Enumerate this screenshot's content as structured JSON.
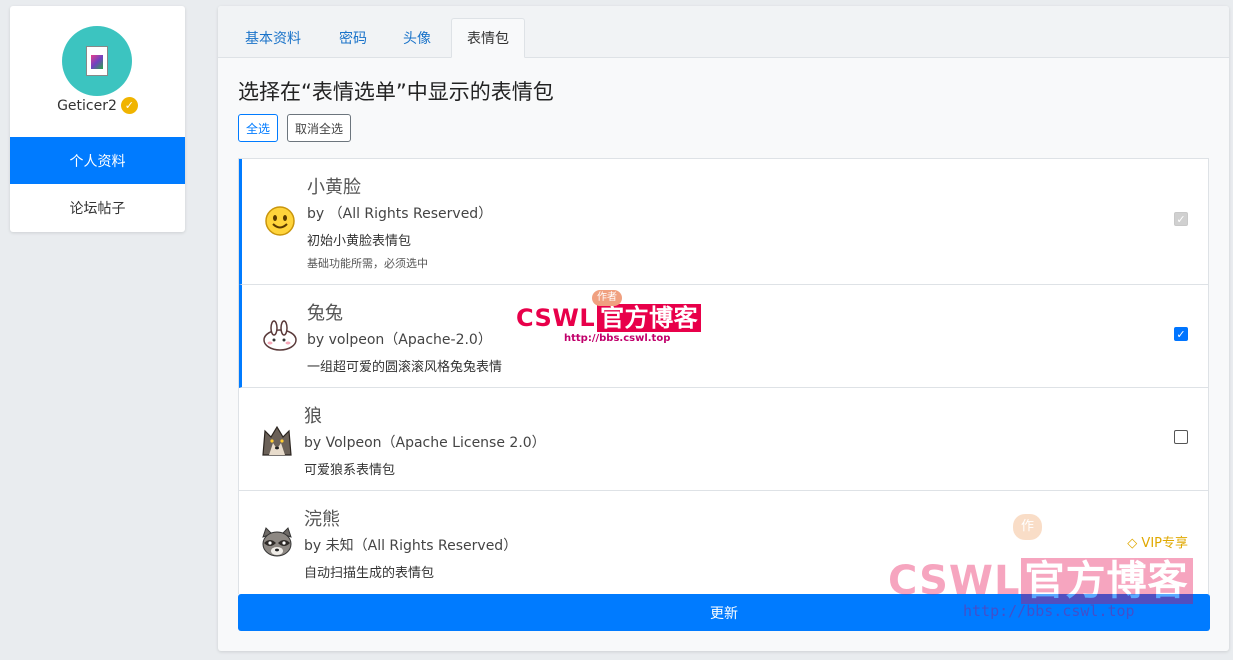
{
  "profile": {
    "username": "Geticer2",
    "nav": [
      {
        "label": "个人资料",
        "active": true
      },
      {
        "label": "论坛帖子",
        "active": false
      }
    ]
  },
  "tabs": [
    {
      "label": "基本资料",
      "active": false
    },
    {
      "label": "密码",
      "active": false
    },
    {
      "label": "头像",
      "active": false
    },
    {
      "label": "表情包",
      "active": true
    }
  ],
  "heading": "选择在“表情选单”中显示的表情包",
  "buttons": {
    "select_all": "全选",
    "deselect_all": "取消全选",
    "update": "更新"
  },
  "packs": [
    {
      "title": "小黄脸",
      "by": "by （All Rights Reserved）",
      "desc": "初始小黄脸表情包",
      "note": "基础功能所需，必须选中",
      "icon": "smiley-face-icon",
      "checked": true,
      "disabled": true
    },
    {
      "title": "兔兔",
      "by": "by volpeon（Apache-2.0）",
      "desc": "一组超可爱的圆滚滚风格兔兔表情",
      "note": "",
      "icon": "bunny-icon",
      "checked": true,
      "disabled": false
    },
    {
      "title": "狼",
      "by": "by Volpeon（Apache License 2.0）",
      "desc": "可爱狼系表情包",
      "note": "",
      "icon": "wolf-icon",
      "checked": false,
      "disabled": false
    },
    {
      "title": "浣熊",
      "by": "by 未知（All Rights Reserved）",
      "desc": "自动扫描生成的表情包",
      "note": "",
      "icon": "raccoon-icon",
      "checked": false,
      "disabled": false
    }
  ],
  "vip_badge": "VIP专享",
  "watermark": {
    "badge": "作者",
    "text_a": "CSWL",
    "text_b": "官方博客",
    "url": "http://bbs.cswl.top"
  },
  "colors": {
    "primary": "#007bff",
    "avatar_bg": "#3cc4c0",
    "verified": "#f0b400",
    "watermark": "#e8004a"
  }
}
